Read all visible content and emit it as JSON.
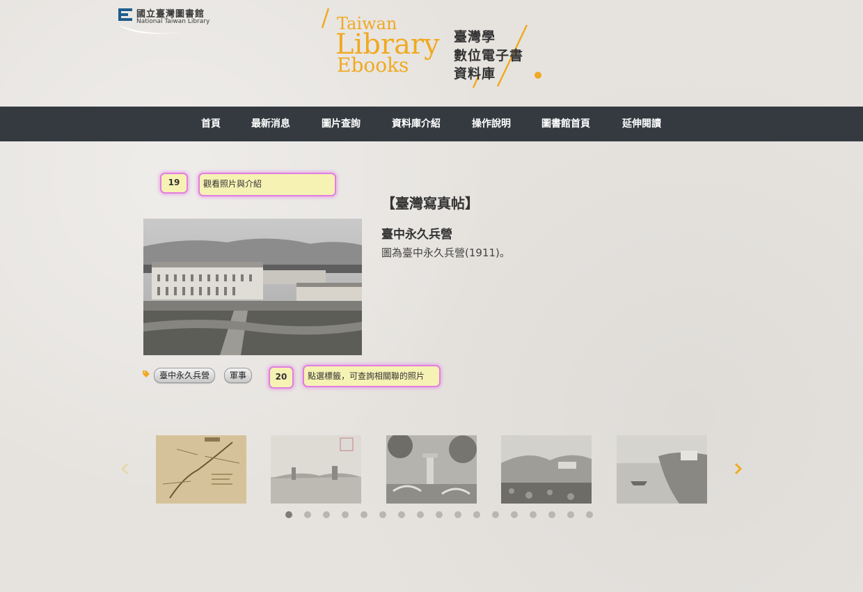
{
  "header": {
    "library_name_cn": "國立臺灣圖書館",
    "library_name_en": "National Taiwan Library",
    "brand_en_line1": "Taiwan",
    "brand_en_line2": "Library",
    "brand_en_line3": "Ebooks",
    "brand_cn_line1": "臺灣學",
    "brand_cn_line2": "數位電子書",
    "brand_cn_line3": "資料庫",
    "brand_color": "#f0a921"
  },
  "nav": {
    "items": [
      {
        "label": "首頁"
      },
      {
        "label": "最新消息"
      },
      {
        "label": "圖片查詢"
      },
      {
        "label": "資料庫介紹"
      },
      {
        "label": "操作說明"
      },
      {
        "label": "圖書館首頁"
      },
      {
        "label": "延伸閱讀"
      }
    ]
  },
  "annotations": {
    "step1_number": "19",
    "step1_text": "觀看照片與介紹",
    "step2_number": "20",
    "step2_text": "點選標籤，可查詢相關聯的照片"
  },
  "detail": {
    "collection": "【臺灣寫真帖】",
    "title": "臺中永久兵營",
    "description": "圖為臺中永久兵營(1911)。"
  },
  "tags": [
    {
      "label": "臺中永久兵營"
    },
    {
      "label": "軍事"
    }
  ],
  "carousel": {
    "thumbnail_count": 5,
    "page_count": 17,
    "active_page": 1,
    "arrow_color": "#f0a921"
  }
}
